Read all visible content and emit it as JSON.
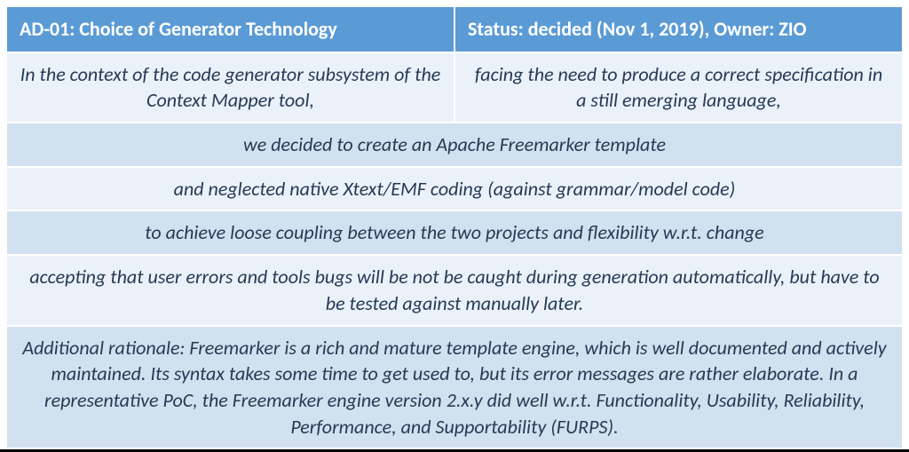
{
  "header": {
    "left": "AD-01: Choice of Generator Technology",
    "right": "Status: decided (Nov 1, 2019), Owner: ZIO"
  },
  "rows": [
    {
      "kind": "split",
      "shade": "light",
      "left": "In the context of the code generator subsystem of the Context Mapper tool,",
      "right": "facing the need to produce a correct specification in a still emerging language,"
    },
    {
      "kind": "full",
      "shade": "dark",
      "text": "we decided to create an Apache Freemarker template"
    },
    {
      "kind": "full",
      "shade": "light",
      "text": "and neglected native Xtext/EMF coding (against grammar/model code)"
    },
    {
      "kind": "full",
      "shade": "dark",
      "text": "to achieve loose coupling between the two projects and flexibility w.r.t. change"
    },
    {
      "kind": "full",
      "shade": "light",
      "text": "accepting that user errors and tools bugs will be not be caught during generation automatically, but have to be tested against manually later."
    },
    {
      "kind": "full",
      "shade": "dark",
      "text": "Additional rationale: Freemarker is a rich and mature template engine, which is well documented and actively maintained. Its syntax takes some time to get used to, but its error messages are rather elaborate. In a representative PoC, the Freemarker engine version 2.x.y did well w.r.t. Functionality, Usability, Reliability, Performance, and Supportability (FURPS)."
    }
  ]
}
